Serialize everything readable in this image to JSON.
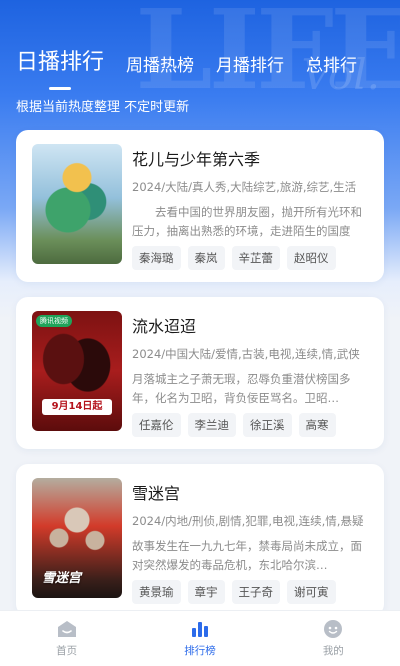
{
  "header": {
    "tabs": [
      {
        "label": "日播排行",
        "active": true
      },
      {
        "label": "周播热榜",
        "active": false
      },
      {
        "label": "月播排行",
        "active": false
      },
      {
        "label": "总排行",
        "active": false
      }
    ],
    "subtitle": "根据当前热度整理 不定时更新"
  },
  "shows": [
    {
      "title": "花儿与少年第六季",
      "meta": "2024/大陆/真人秀,大陆综艺,旅游,综艺,生活",
      "description": "　　去看中国的世界朋友圈，抛开所有光环和压力，抽离出熟悉的环境，走进陌生的国度",
      "cast": [
        "秦海璐",
        "秦岚",
        "辛芷蕾",
        "赵昭仪"
      ]
    },
    {
      "title": "流水迢迢",
      "meta": "2024/中国大陆/爱情,古装,电视,连续,情,武侠",
      "description": "月落城主之子萧无瑕，忍辱负重潜伏榜国多年，化名为卫昭，背负佞臣骂名。卫昭…",
      "cast": [
        "任嘉伦",
        "李兰迪",
        "徐正溪",
        "高寒"
      ],
      "poster_badge": "腾讯视频",
      "poster_date": "9月14日起"
    },
    {
      "title": "雪迷宫",
      "meta": "2024/内地/刑侦,剧情,犯罪,电视,连续,情,悬疑",
      "description": "故事发生在一九九七年，禁毒局尚未成立，面对突然爆发的毒品危机，东北哈尔滨…",
      "cast": [
        "黄景瑜",
        "章宇",
        "王子奇",
        "谢可寅"
      ],
      "poster_logo": "雪迷宫"
    }
  ],
  "bottom_nav": [
    {
      "label": "首页",
      "icon": "home-icon",
      "active": false
    },
    {
      "label": "排行榜",
      "icon": "ranking-icon",
      "active": true
    },
    {
      "label": "我的",
      "icon": "profile-icon",
      "active": false
    }
  ],
  "colors": {
    "accent": "#2c6bea",
    "hero_top": "#1e63e0",
    "card": "#ffffff",
    "background": "#f0f3f8"
  }
}
